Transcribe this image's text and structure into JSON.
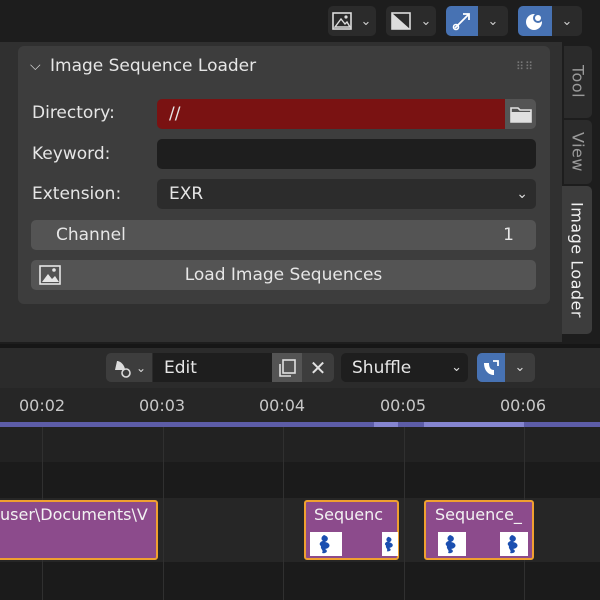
{
  "panel": {
    "title": "Image Sequence Loader",
    "directory_label": "Directory:",
    "directory_value": "//",
    "keyword_label": "Keyword:",
    "keyword_value": "",
    "extension_label": "Extension:",
    "extension_value": "EXR",
    "channel_label": "Channel",
    "channel_value": "1",
    "load_button": "Load Image Sequences"
  },
  "tabs": [
    "Tool",
    "View",
    "Image Loader"
  ],
  "sequencer": {
    "mode": "Edit",
    "blend": "Shuffle"
  },
  "ruler": {
    "ticks": [
      "00:02",
      "00:03",
      "00:04",
      "00:05",
      "00:06"
    ]
  },
  "strips": [
    {
      "label": "user\\Documents\\V"
    },
    {
      "label": "Sequenc"
    },
    {
      "label": "Sequence_"
    }
  ],
  "colors": {
    "accent": "#4772b3",
    "strip": "#8c4b8c",
    "strip_border": "#f0a030",
    "directory_error": "#7a1212"
  }
}
